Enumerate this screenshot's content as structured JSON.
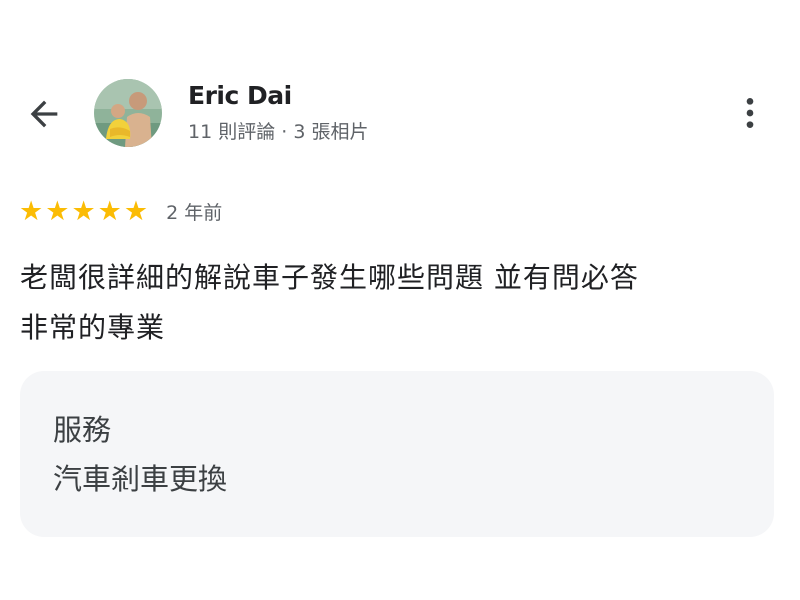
{
  "reviewer": {
    "name": "Eric Dai",
    "meta": "11 則評論 · 3 張相片"
  },
  "review": {
    "rating": 5,
    "max_rating": 5,
    "stars": [
      "★",
      "★",
      "★",
      "★",
      "★"
    ],
    "date": "2 年前",
    "text_lines": [
      "老闆很詳細的解說車子發生哪些問題 並有問必答",
      "非常的專業"
    ]
  },
  "service": {
    "title": "服務",
    "value": "汽車剎車更換"
  },
  "icons": {
    "back": "arrow-back-icon",
    "more": "more-vert-icon",
    "star": "star-icon"
  },
  "colors": {
    "star": "#fbbc04",
    "text": "#202124",
    "secondary_text": "#5f6368",
    "card_background": "#f5f6f8"
  }
}
